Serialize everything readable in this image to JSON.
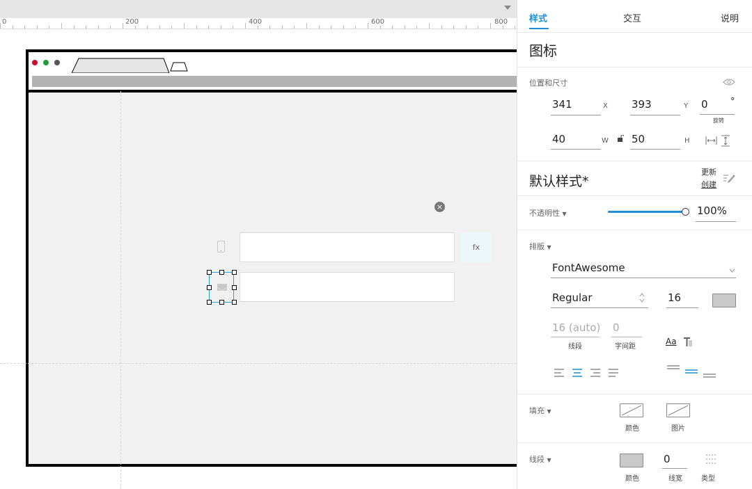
{
  "ruler": {
    "labels": [
      "0",
      "200",
      "400",
      "600",
      "800"
    ]
  },
  "canvas": {
    "fx_label": "fx",
    "close_glyph": "×"
  },
  "panel": {
    "tabs": [
      "样式",
      "交互",
      "说明"
    ],
    "component_title": "图标",
    "position_size": {
      "label": "位置和尺寸",
      "x_value": "341",
      "x_unit": "X",
      "y_value": "393",
      "y_unit": "Y",
      "rotation_value": "0",
      "rotation_unit": "°",
      "rotation_label": "旋转",
      "w_value": "40",
      "w_unit": "W",
      "h_value": "50",
      "h_unit": "H"
    },
    "default_style": {
      "title": "默认样式*",
      "update_link": "更新",
      "create_link": "创建"
    },
    "opacity": {
      "label": "不透明性",
      "value": "100%",
      "level": 1.0
    },
    "typography": {
      "label": "排版",
      "font_family": "FontAwesome",
      "font_weight": "Regular",
      "font_size": "16",
      "line_height_value": "16 (auto)",
      "line_height_label": "线段",
      "letter_spacing_value": "0",
      "letter_spacing_label": "字间距",
      "text_options_label": "Aa"
    },
    "fill": {
      "label": "填充",
      "color_label": "颜色",
      "image_label": "图片"
    },
    "border": {
      "label": "线段",
      "color_label": "颜色",
      "width_value": "0",
      "width_label": "线宽",
      "type_label": "类型"
    },
    "colors": {
      "accent": "#1e8fd4",
      "selection": "#23a9d4"
    },
    "icons": [
      "eye-icon",
      "lock-icon",
      "width-arrows-icon",
      "height-arrows-icon",
      "edit-icon",
      "chevron-down-icon",
      "align-left-icon",
      "align-center-icon",
      "align-right-icon",
      "align-justify-icon",
      "valign-top-icon",
      "valign-middle-icon",
      "valign-bottom-icon",
      "text-shadow-icon"
    ]
  }
}
